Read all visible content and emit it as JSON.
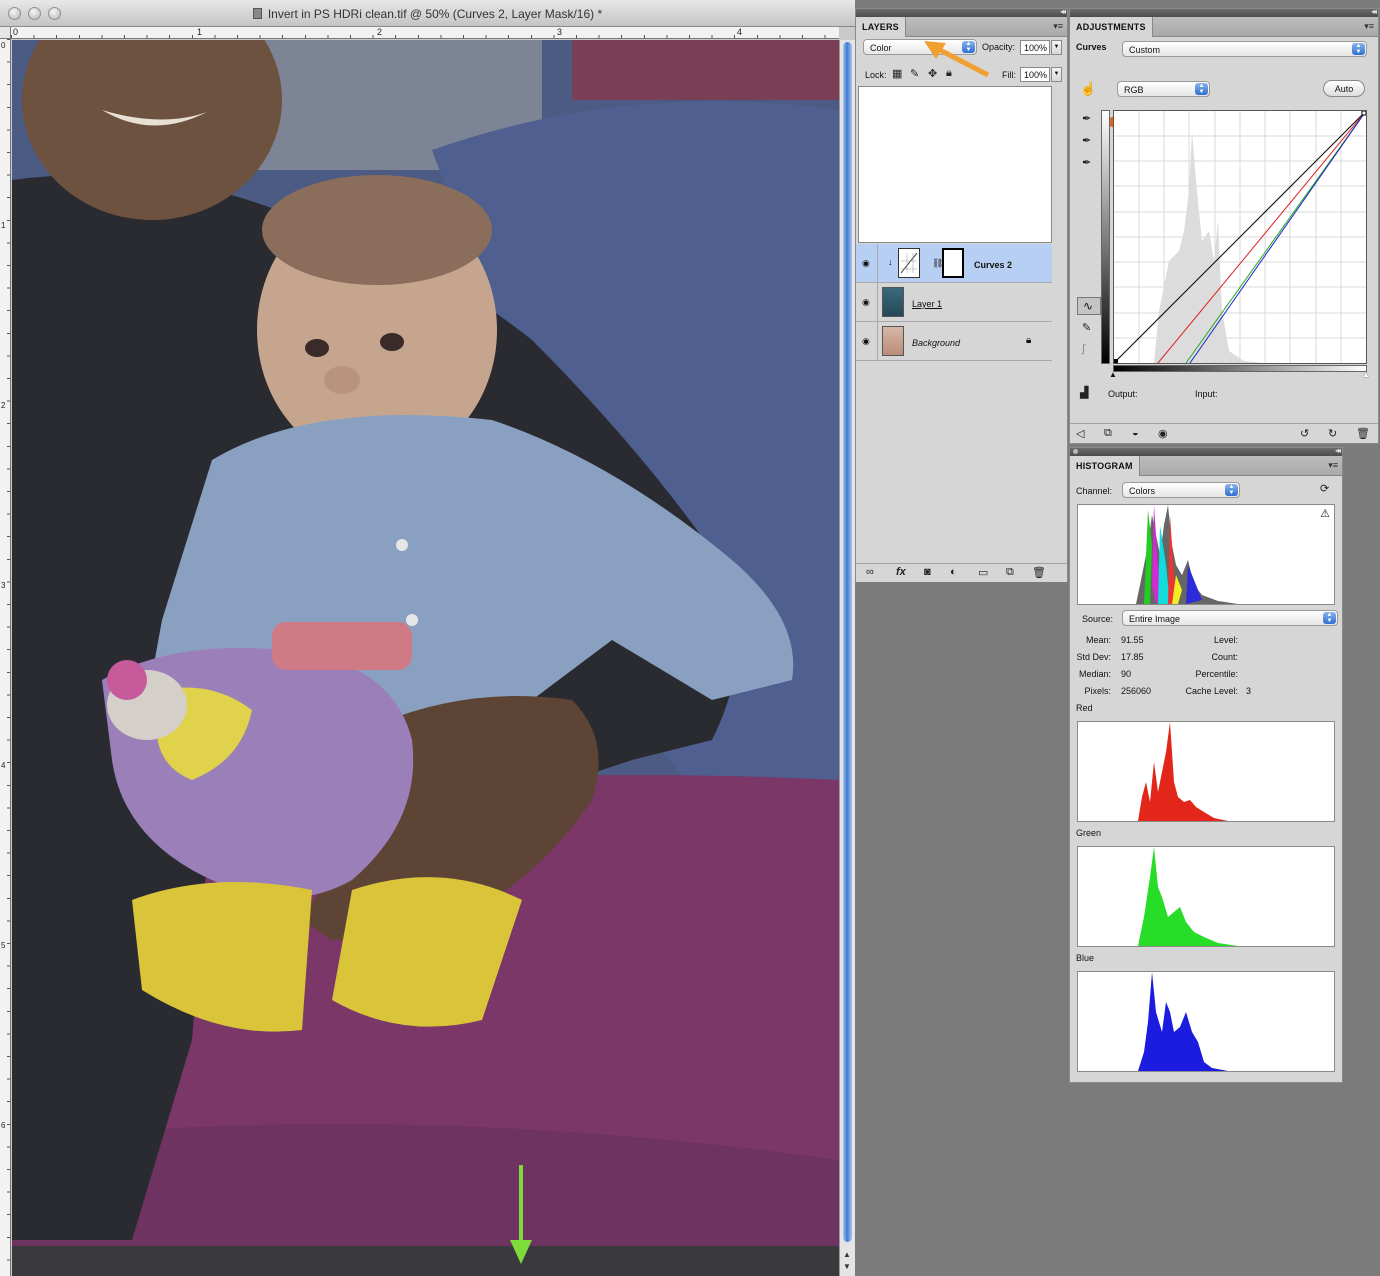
{
  "document": {
    "title": "Invert in PS HDRi clean.tif @ 50% (Curves 2, Layer Mask/16) *",
    "ruler_h": [
      "0",
      "1",
      "2",
      "3",
      "4"
    ],
    "ruler_v": [
      "0",
      "1",
      "2",
      "3",
      "4",
      "5",
      "6"
    ]
  },
  "layers_panel": {
    "tab": "LAYERS",
    "blend_mode": "Color",
    "opacity_label": "Opacity:",
    "opacity_value": "100%",
    "lock_label": "Lock:",
    "fill_label": "Fill:",
    "fill_value": "100%",
    "layers": [
      {
        "name": "Curves 2",
        "selected": true
      },
      {
        "name": "Layer 1",
        "selected": false
      },
      {
        "name": "Background",
        "selected": false
      }
    ]
  },
  "adjustments_panel": {
    "tab": "ADJUSTMENTS",
    "title": "Curves",
    "preset": "Custom",
    "channel": "RGB",
    "auto_button": "Auto",
    "output_label": "Output:",
    "input_label": "Input:"
  },
  "histogram_panel": {
    "tab": "HISTOGRAM",
    "channel_label": "Channel:",
    "channel_value": "Colors",
    "source_label": "Source:",
    "source_value": "Entire Image",
    "stats_left": [
      {
        "label": "Mean:",
        "value": "91.55"
      },
      {
        "label": "Std Dev:",
        "value": "17.85"
      },
      {
        "label": "Median:",
        "value": "90"
      },
      {
        "label": "Pixels:",
        "value": "256060"
      }
    ],
    "stats_right": [
      {
        "label": "Level:",
        "value": ""
      },
      {
        "label": "Count:",
        "value": ""
      },
      {
        "label": "Percentile:",
        "value": ""
      },
      {
        "label": "Cache Level:",
        "value": "3"
      }
    ],
    "channel_names": {
      "red": "Red",
      "green": "Green",
      "blue": "Blue"
    }
  },
  "colors": {
    "annotation_orange_1": "#f0a030",
    "annotation_orange_2": "#e8621a",
    "annotation_green": "#7ddc3a",
    "selection_blue": "#b7cff2"
  },
  "icons": [
    "close-button",
    "minimize-button",
    "zoom-button",
    "eye-icon",
    "lock-icon",
    "link-icon",
    "fx-icon",
    "mask-icon",
    "adjustment-icon",
    "folder-icon",
    "new-layer-icon",
    "trash-icon",
    "hand-icon",
    "eyedropper-icon",
    "curve-icon",
    "pencil-icon",
    "smooth-icon",
    "clip-icon",
    "refresh-icon",
    "warning-icon"
  ]
}
